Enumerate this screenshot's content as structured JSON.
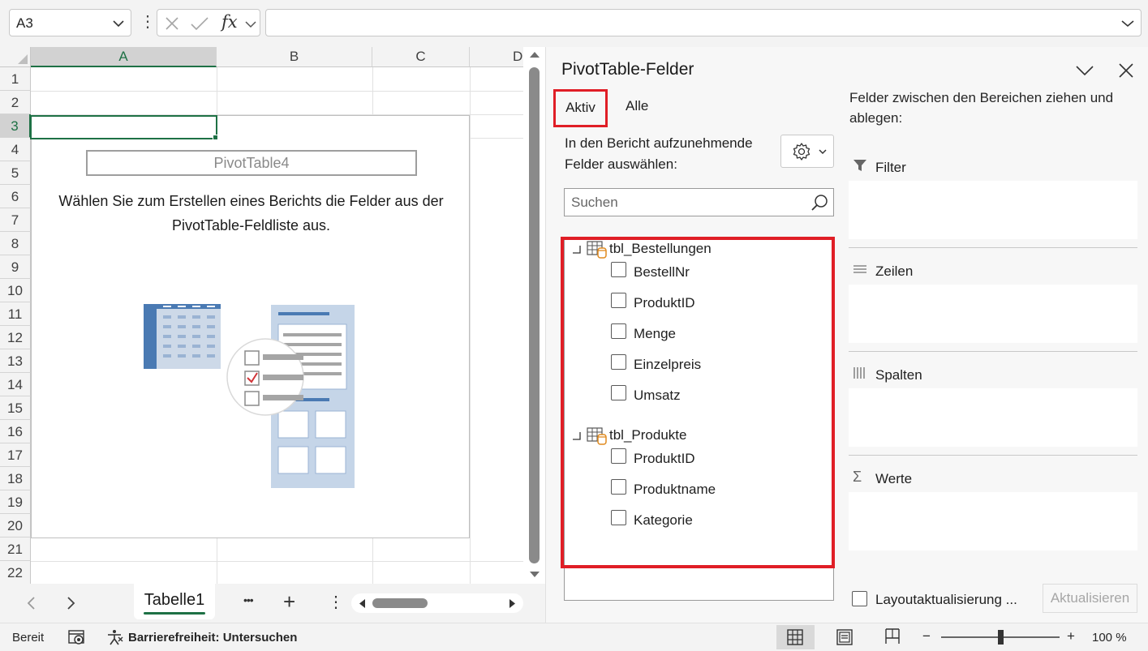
{
  "formula_bar": {
    "name_box": "A3",
    "fx_label": "fx",
    "formula_value": ""
  },
  "sheet": {
    "columns": [
      "A",
      "B",
      "C",
      "D"
    ],
    "rows": [
      "1",
      "2",
      "3",
      "4",
      "5",
      "6",
      "7",
      "8",
      "9",
      "10",
      "11",
      "12",
      "13",
      "14",
      "15",
      "16",
      "17",
      "18",
      "19",
      "20",
      "21",
      "22"
    ],
    "pivot_name": "PivotTable4",
    "instruction_line1": "Wählen Sie zum Erstellen eines Berichts die Felder aus der",
    "instruction_line2": "PivotTable-Feldliste aus."
  },
  "tabs": {
    "sheet_tab": "Tabelle1",
    "more": "•••",
    "add": "+",
    "options": "⋮"
  },
  "status": {
    "ready": "Bereit",
    "accessibility": "Barrierefreiheit: Untersuchen",
    "zoom_minus": "−",
    "zoom_plus": "+",
    "zoom": "100 %",
    "zoom_level": 0.5
  },
  "pane": {
    "title": "PivotTable-Felder",
    "tab_active": "Aktiv",
    "tab_all": "Alle",
    "choose_label_line1": "In den Bericht aufzunehmende",
    "choose_label_line2": "Felder auswählen:",
    "search_placeholder": "Suchen",
    "tables": [
      {
        "name": "tbl_Bestellungen",
        "fields": [
          "BestellNr",
          "ProduktID",
          "Menge",
          "Einzelpreis",
          "Umsatz"
        ]
      },
      {
        "name": "tbl_Produkte",
        "fields": [
          "ProduktID",
          "Produktname",
          "Kategorie"
        ]
      }
    ],
    "areas_hint_line1": "Felder zwischen den Bereichen ziehen und",
    "areas_hint_line2": "ablegen:",
    "areas": {
      "filter": "Filter",
      "rows": "Zeilen",
      "columns": "Spalten",
      "values": "Werte"
    },
    "defer_layout": "Layoutaktualisierung ...",
    "update": "Aktualisieren"
  },
  "colors": {
    "accent_green": "#1e7145",
    "highlight_red": "#e01e26"
  }
}
